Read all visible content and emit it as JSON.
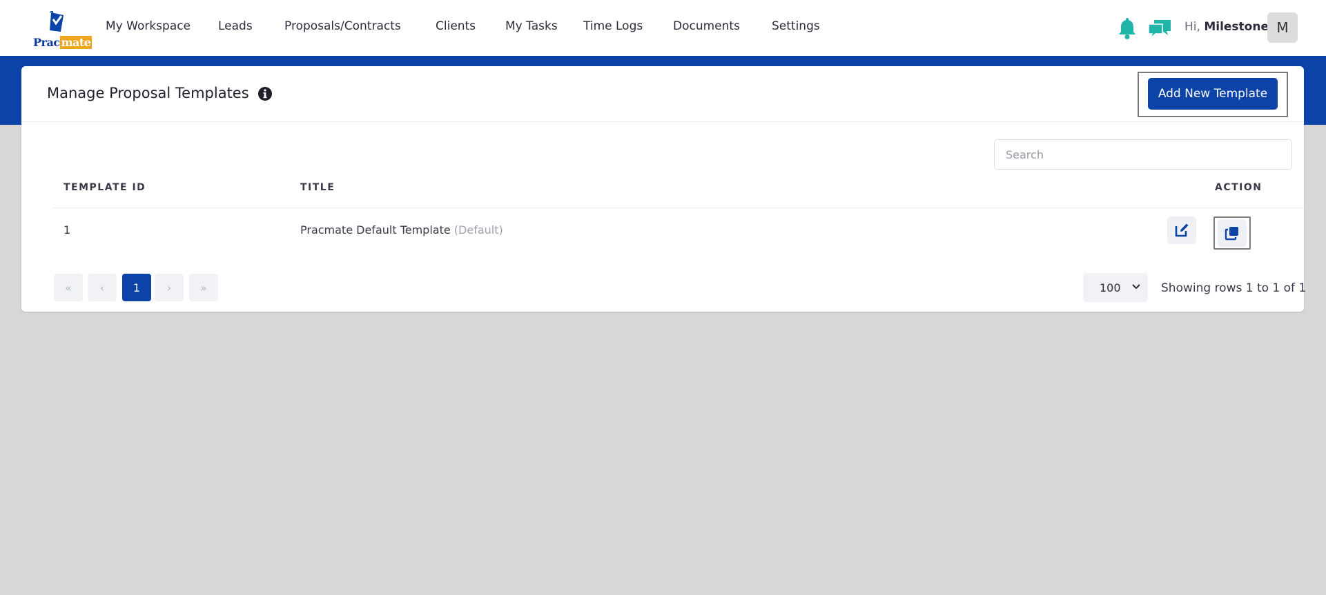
{
  "app": {
    "logo_text_a": "Prac",
    "logo_text_b": "mate"
  },
  "nav": {
    "items": [
      {
        "label": "My Workspace"
      },
      {
        "label": "Leads"
      },
      {
        "label": "Proposals/Contracts"
      },
      {
        "label": "Clients"
      },
      {
        "label": "My Tasks"
      },
      {
        "label": "Time Logs"
      },
      {
        "label": "Documents"
      },
      {
        "label": "Settings"
      }
    ],
    "greeting_prefix": "Hi,",
    "user_name": "Milestone",
    "avatar_initial": "M",
    "icons": [
      "bell-icon",
      "chat-icon"
    ]
  },
  "page": {
    "title": "Manage Proposal Templates",
    "add_button": "Add New Template",
    "search_placeholder": "Search"
  },
  "table": {
    "columns": [
      "TEMPLATE ID",
      "TITLE",
      "ACTION"
    ],
    "rows": [
      {
        "id": "1",
        "title": "Pracmate Default Template",
        "tag": "(Default)"
      }
    ]
  },
  "pagination": {
    "first": "«",
    "prev": "‹",
    "current": "1",
    "next": "›",
    "last": "»",
    "per_page": "100",
    "showing": "Showing rows 1 to  1 of 1"
  },
  "colors": {
    "brand_blue": "#0b43a8",
    "accent_teal": "#1fb5a8",
    "logo_orange": "#f0a61c"
  }
}
